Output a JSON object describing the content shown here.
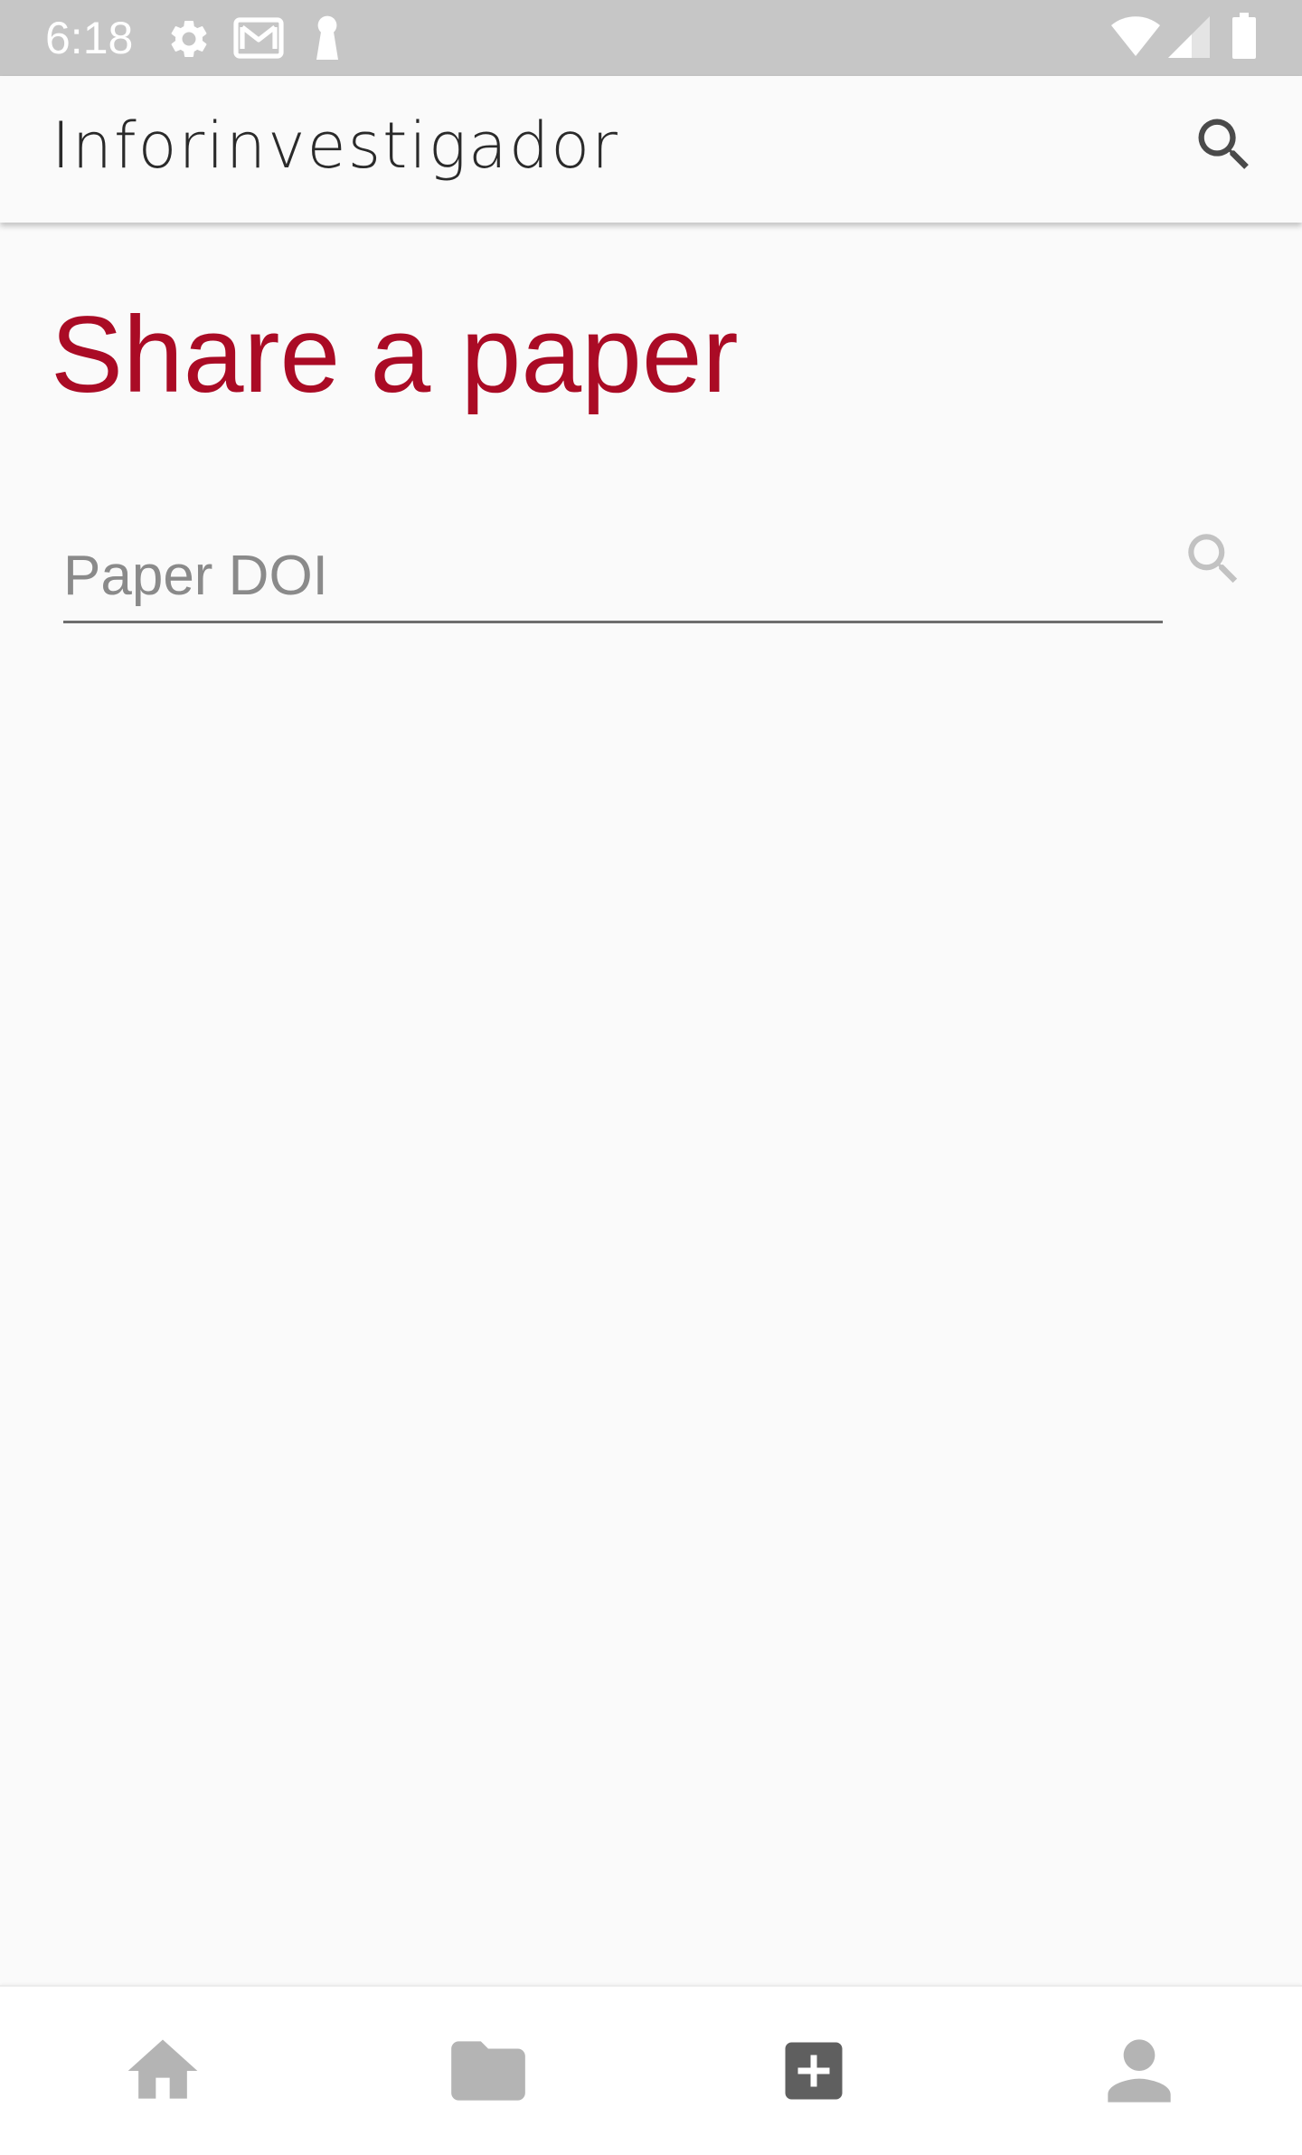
{
  "status_bar": {
    "time": "6:18",
    "icons": [
      "settings-icon",
      "gmail-icon",
      "keyhole-icon",
      "wifi-icon",
      "cellular-signal-icon",
      "battery-icon"
    ]
  },
  "app_bar": {
    "title": "Inforinvestigador",
    "search_icon": "search-icon"
  },
  "main": {
    "heading": "Share a paper",
    "doi_input": {
      "placeholder": "Paper DOI",
      "value": ""
    },
    "doi_search_icon": "search-icon"
  },
  "bottom_nav": {
    "items": [
      {
        "icon": "home-icon",
        "active": false
      },
      {
        "icon": "folder-icon",
        "active": false
      },
      {
        "icon": "add-box-icon",
        "active": true
      },
      {
        "icon": "person-icon",
        "active": false
      }
    ]
  },
  "colors": {
    "accent": "#aa0b25",
    "status_bar_bg": "#c6c6c6",
    "page_bg": "#fafafa",
    "nav_icon_inactive": "#b4b4b4",
    "nav_icon_active": "#5f5f5f"
  }
}
